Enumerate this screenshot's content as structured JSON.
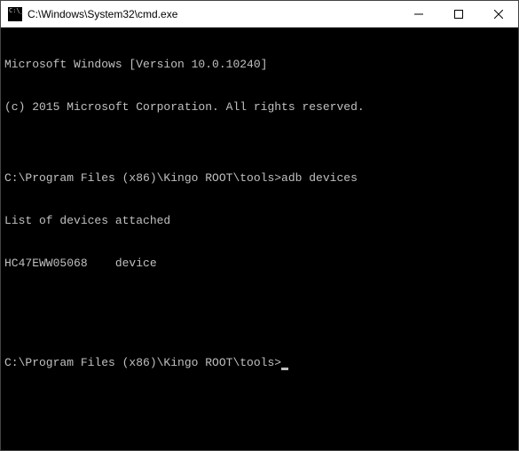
{
  "window": {
    "title": "C:\\Windows\\System32\\cmd.exe"
  },
  "terminal": {
    "lines": [
      "Microsoft Windows [Version 10.0.10240]",
      "(c) 2015 Microsoft Corporation. All rights reserved.",
      "",
      "C:\\Program Files (x86)\\Kingo ROOT\\tools>adb devices",
      "List of devices attached",
      "HC47EWW05068    device",
      "",
      "",
      "C:\\Program Files (x86)\\Kingo ROOT\\tools>"
    ]
  }
}
